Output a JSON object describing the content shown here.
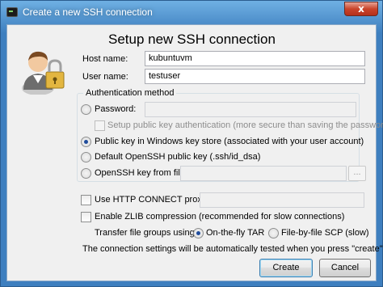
{
  "window": {
    "title": "Create a new SSH connection",
    "close_glyph": "x"
  },
  "heading": "Setup new SSH connection",
  "fields": {
    "host_label": "Host name:",
    "host_value": "kubuntuvm",
    "user_label": "User name:",
    "user_value": "testuser"
  },
  "auth": {
    "legend": "Authentication method",
    "password_label": "Password:",
    "password_value": "",
    "setup_pubkey_label": "Setup public key authentication (more secure than saving the password)",
    "windows_keystore_label": "Public key in Windows key store (associated with your user account)",
    "default_openssh_label": "Default OpenSSH public key (.ssh/id_dsa)",
    "openssh_file_label": "OpenSSH key from file:",
    "openssh_file_value": "",
    "browse_label": "...",
    "selected": "windows_keystore"
  },
  "options": {
    "http_proxy_label": "Use HTTP CONNECT proxy:",
    "http_proxy_value": "",
    "zlib_label": "Enable ZLIB compression (recommended for slow connections)",
    "transfer_label": "Transfer file groups using:",
    "transfer_tar_label": "On-the-fly TAR",
    "transfer_scp_label": "File-by-file SCP (slow)",
    "transfer_selected": "tar"
  },
  "note": "The connection settings will be automatically tested when you press \"create\".",
  "buttons": {
    "create": "Create",
    "cancel": "Cancel"
  }
}
